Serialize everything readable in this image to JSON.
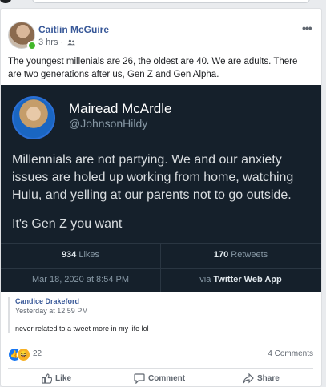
{
  "post": {
    "author": "Caitlin McGuire",
    "time": "3 hrs",
    "separator": "·",
    "more": "•••",
    "text": "The youngest millenials are 26, the oldest are 40. We are adults. There are two generations after us, Gen Z and Gen Alpha."
  },
  "tweet": {
    "name": "Mairead McArdle",
    "handle": "@JohnsonHildy",
    "body": "Millennials are not partying. We and our anxiety issues are holed up working from home, watching Hulu, and yelling at our parents not to go outside.",
    "body2": "It's Gen Z you want",
    "likes_count": "934",
    "likes_label": "Likes",
    "retweets_count": "170",
    "retweets_label": "Retweets",
    "date": "Mar 18, 2020 at 8:54 PM",
    "via_prefix": "via",
    "via_source": "Twitter Web App"
  },
  "comment": {
    "author": "Candice Drakeford",
    "time": "Yesterday at 12:59 PM",
    "text": "never related to a tweet more in my life lol"
  },
  "stats": {
    "reactions": "22",
    "comments": "4 Comments"
  },
  "actions": {
    "like": "Like",
    "comment": "Comment",
    "share": "Share"
  },
  "colors": {
    "link_blue": "#385898",
    "tweet_bg": "#15202b",
    "online_green": "#42b72a"
  }
}
